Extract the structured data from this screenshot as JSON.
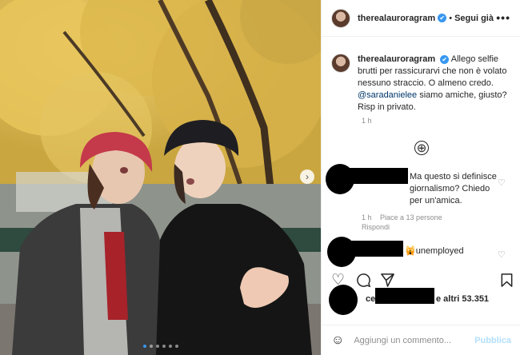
{
  "post": {
    "username": "therealauroragram",
    "verified_icon": "✔",
    "separator": "•",
    "follow_label": "Segui già",
    "more_icon": "•••"
  },
  "caption": {
    "username": "therealauroragram",
    "text_before": "Allego selfie brutti per rassicurarvi che non è volato nessuno straccio. O almeno credo. ",
    "mention": "@saradanielee",
    "text_after": " siamo amiche, giusto? Risp in privato.",
    "time": "1 h"
  },
  "load_more_icon": "⊕",
  "comments": [
    {
      "text": "Ma questo si definisce giornalismo? Chiedo per un'amica.",
      "time": "1 h",
      "likes": "Piace a 13 persone",
      "reply": "Rispondi"
    },
    {
      "emoji": "🙀",
      "text": "unemployed"
    }
  ],
  "likes": {
    "prefix": "ce",
    "suffix": "e altri 53.351"
  },
  "comment_bar": {
    "placeholder": "Aggiungi un commento...",
    "publish_label": "Pubblica"
  },
  "carousel": {
    "next_icon": "›",
    "count": 6,
    "active": 0
  },
  "colors": {
    "accent": "#3897f0",
    "publish_disabled": "#b2dffc",
    "muted": "#8e8e8e"
  }
}
